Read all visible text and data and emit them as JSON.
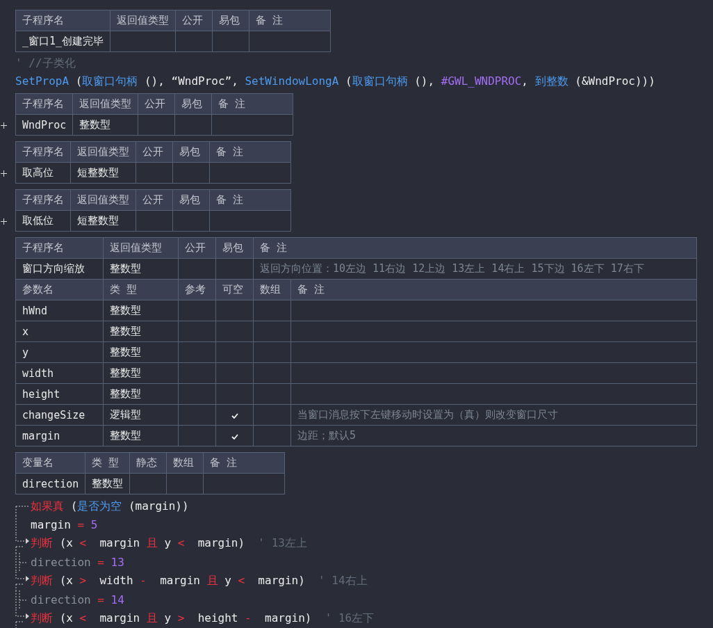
{
  "items": [
    {
      "kind": "table",
      "sections": [
        {
          "kind": "sub",
          "header": [
            "子程序名",
            "返回值类型",
            "公开",
            "易包",
            "备 注"
          ],
          "rows": [
            {
              "cells": [
                "_窗口1_创建完毕",
                "",
                "",
                "",
                ""
              ]
            }
          ]
        }
      ]
    },
    {
      "kind": "line",
      "tokens": [
        {
          "kind": "cmt",
          "text": "' //子类化"
        }
      ]
    },
    {
      "kind": "line",
      "tokens": [
        {
          "kind": "fn",
          "text": "SetPropA"
        },
        {
          "kind": "plain",
          "text": " ("
        },
        {
          "kind": "fn",
          "text": "取窗口句柄"
        },
        {
          "kind": "plain",
          "text": " (), “WndProc”, "
        },
        {
          "kind": "fn",
          "text": "SetWindowLongA"
        },
        {
          "kind": "plain",
          "text": " ("
        },
        {
          "kind": "fn",
          "text": "取窗口句柄"
        },
        {
          "kind": "plain",
          "text": " (), "
        },
        {
          "kind": "const",
          "text": "#GWL_WNDPROC"
        },
        {
          "kind": "plain",
          "text": ", "
        },
        {
          "kind": "fn",
          "text": "到整数"
        },
        {
          "kind": "plain",
          "text": " (&WndProc)))"
        }
      ]
    },
    {
      "kind": "table",
      "collapsed": true,
      "sections": [
        {
          "kind": "sub",
          "header": [
            "子程序名",
            "返回值类型",
            "公开",
            "易包",
            "备 注"
          ],
          "rows": [
            {
              "cells": [
                "WndProc",
                "整数型",
                "",
                "",
                ""
              ]
            }
          ]
        }
      ]
    },
    {
      "kind": "table",
      "collapsed": true,
      "sections": [
        {
          "kind": "sub",
          "header": [
            "子程序名",
            "返回值类型",
            "公开",
            "易包",
            "备 注"
          ],
          "rows": [
            {
              "cells": [
                "取高位",
                "短整数型",
                "",
                "",
                ""
              ]
            }
          ]
        }
      ]
    },
    {
      "kind": "table",
      "collapsed": true,
      "sections": [
        {
          "kind": "sub",
          "header": [
            "子程序名",
            "返回值类型",
            "公开",
            "易包",
            "备 注"
          ],
          "rows": [
            {
              "cells": [
                "取低位",
                "短整数型",
                "",
                "",
                ""
              ]
            }
          ]
        }
      ]
    },
    {
      "kind": "table",
      "sections": [
        {
          "kind": "sub",
          "header": [
            "子程序名",
            "返回值类型",
            "公开",
            "易包",
            "备 注"
          ],
          "rows": [
            {
              "cells": [
                "窗口方向缩放",
                "整数型",
                "",
                "",
                "返回方向位置：10左边 11右边 12上边 13左上 14右上 15下边 16左下 17右下"
              ]
            }
          ]
        },
        {
          "kind": "params",
          "header": [
            "参数名",
            "类 型",
            "参考",
            "可空",
            "数组",
            "备 注"
          ],
          "rows": [
            {
              "cells": [
                "hWnd",
                "整数型",
                "",
                "",
                "",
                ""
              ],
              "optional": false
            },
            {
              "cells": [
                "x",
                "整数型",
                "",
                "",
                "",
                ""
              ],
              "optional": false
            },
            {
              "cells": [
                "y",
                "整数型",
                "",
                "",
                "",
                ""
              ],
              "optional": false
            },
            {
              "cells": [
                "width",
                "整数型",
                "",
                "",
                "",
                ""
              ],
              "optional": false
            },
            {
              "cells": [
                "height",
                "整数型",
                "",
                "",
                "",
                ""
              ],
              "optional": false
            },
            {
              "cells": [
                "changeSize",
                "逻辑型",
                "",
                "",
                "",
                "当窗口消息按下左键移动时设置为（真）则改变窗口尺寸"
              ],
              "optional": true
            },
            {
              "cells": [
                "margin",
                "整数型",
                "",
                "",
                "",
                "边距；默认5"
              ],
              "optional": true
            }
          ]
        }
      ]
    },
    {
      "kind": "table",
      "sections": [
        {
          "kind": "vars",
          "header": [
            "变量名",
            "类 型",
            "静态",
            "数组",
            "备 注"
          ],
          "rows": [
            {
              "cells": [
                "direction",
                "整数型",
                "",
                "",
                ""
              ]
            }
          ]
        }
      ]
    },
    {
      "kind": "line",
      "marker": {
        "kind": "start"
      },
      "tokens": [
        {
          "kind": "kw",
          "text": "如果真"
        },
        {
          "kind": "plain",
          "text": " ("
        },
        {
          "kind": "fn",
          "text": "是否为空"
        },
        {
          "kind": "plain",
          "text": " (margin))"
        }
      ]
    },
    {
      "kind": "line",
      "marker": {
        "kind": "body"
      },
      "tokens": [
        {
          "kind": "plain",
          "text": "margin"
        },
        {
          "kind": "op",
          "text": " = "
        },
        {
          "kind": "num",
          "text": "5"
        }
      ]
    },
    {
      "kind": "line",
      "marker": {
        "kind": "branch"
      },
      "tokens": [
        {
          "kind": "kw",
          "text": "判断"
        },
        {
          "kind": "plain",
          "text": " (x "
        },
        {
          "kind": "op",
          "text": "< "
        },
        {
          "kind": "plain",
          "text": " margin "
        },
        {
          "kind": "kw",
          "text": "且"
        },
        {
          "kind": "plain",
          "text": " y "
        },
        {
          "kind": "op",
          "text": "< "
        },
        {
          "kind": "plain",
          "text": " margin)  "
        },
        {
          "kind": "cmt",
          "text": "' 13左上"
        }
      ]
    },
    {
      "kind": "line",
      "marker": {
        "kind": "inner"
      },
      "tokens": [
        {
          "kind": "dim",
          "text": "direction"
        },
        {
          "kind": "op",
          "text": " = "
        },
        {
          "kind": "num",
          "text": "13"
        }
      ]
    },
    {
      "kind": "line",
      "marker": {
        "kind": "branch"
      },
      "tokens": [
        {
          "kind": "kw",
          "text": "判断"
        },
        {
          "kind": "plain",
          "text": " (x "
        },
        {
          "kind": "op",
          "text": "> "
        },
        {
          "kind": "plain",
          "text": " width "
        },
        {
          "kind": "op",
          "text": "- "
        },
        {
          "kind": "plain",
          "text": " margin "
        },
        {
          "kind": "kw",
          "text": "且"
        },
        {
          "kind": "plain",
          "text": " y "
        },
        {
          "kind": "op",
          "text": "< "
        },
        {
          "kind": "plain",
          "text": " margin)  "
        },
        {
          "kind": "cmt",
          "text": "' 14右上"
        }
      ]
    },
    {
      "kind": "line",
      "marker": {
        "kind": "inner"
      },
      "tokens": [
        {
          "kind": "dim",
          "text": "direction"
        },
        {
          "kind": "op",
          "text": " = "
        },
        {
          "kind": "num",
          "text": "14"
        }
      ]
    },
    {
      "kind": "line",
      "marker": {
        "kind": "branch"
      },
      "tokens": [
        {
          "kind": "kw",
          "text": "判断"
        },
        {
          "kind": "plain",
          "text": " (x "
        },
        {
          "kind": "op",
          "text": "< "
        },
        {
          "kind": "plain",
          "text": " margin "
        },
        {
          "kind": "kw",
          "text": "且"
        },
        {
          "kind": "plain",
          "text": " y "
        },
        {
          "kind": "op",
          "text": "> "
        },
        {
          "kind": "plain",
          "text": " height "
        },
        {
          "kind": "op",
          "text": "- "
        },
        {
          "kind": "plain",
          "text": " margin)  "
        },
        {
          "kind": "cmt",
          "text": "' 16左下"
        }
      ]
    }
  ]
}
